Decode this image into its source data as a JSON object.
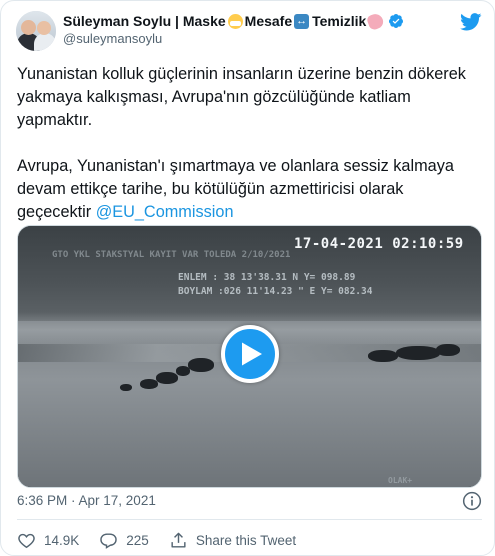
{
  "author": {
    "display_name_parts": [
      "Süleyman Soylu | Maske",
      "Mesafe",
      "Temizlik"
    ],
    "emoji_icons": [
      "mask-face-emoji",
      "left-right-arrow-emoji",
      "soap-emoji"
    ],
    "handle": "@suleymansoylu",
    "verified": true
  },
  "tweet": {
    "paragraph1": "Yunanistan kolluk güçlerinin insanların üzerine benzin dökerek yakmaya kalkışması, Avrupa'nın gözcülüğünde katliam yapmaktır.",
    "paragraph2": "Avrupa, Yunanistan'ı şımartmaya ve olanlara sessiz kalmaya devam ettikçe tarihe, bu kötülüğün azmettiricisi olarak geçecektir ",
    "mention": "@EU_Commission"
  },
  "media": {
    "osd_datetime": "17-04-2021 02:10:59",
    "osd_row1": "GTO    YKL STAKSTYAL KAYIT VAR TOLEDA   2/10/2021",
    "osd_row2": "ENLEM   : 38 13'38.31   N  Y=  098.89",
    "osd_row3": "BOYLAM :026 11'14.23 \"  E  Y=  082.34",
    "osd_corner": "OLAK+"
  },
  "footer": {
    "timestamp": "6:36 PM · Apr 17, 2021",
    "likes": "14.9K",
    "replies": "225",
    "share_label": "Share this Tweet"
  },
  "colors": {
    "accent": "#1d9bf0",
    "mention": "#1b95e0",
    "muted": "#536471",
    "border": "#e1e8ed"
  }
}
